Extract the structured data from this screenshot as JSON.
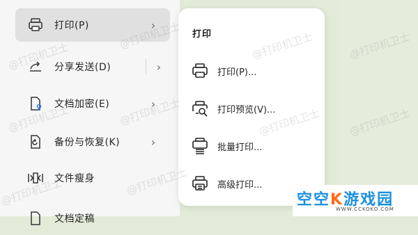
{
  "left_menu": {
    "items": [
      {
        "label": "打印(P)",
        "icon": "printer-icon"
      },
      {
        "label": "分享发送(D)",
        "icon": "share-icon"
      },
      {
        "label": "文档加密(E)",
        "icon": "document-lock-icon"
      },
      {
        "label": "备份与恢复(K)",
        "icon": "backup-icon"
      },
      {
        "label": "文件瘦身",
        "icon": "compress-icon"
      },
      {
        "label": "文档定稿",
        "icon": "document-finalize-icon"
      }
    ]
  },
  "submenu": {
    "title": "打印",
    "items": [
      {
        "label": "打印(P)...",
        "icon": "printer-icon"
      },
      {
        "label": "打印预览(V)...",
        "icon": "print-preview-icon"
      },
      {
        "label": "批量打印...",
        "icon": "batch-print-icon"
      },
      {
        "label": "高级打印...",
        "icon": "advanced-print-icon"
      }
    ]
  },
  "watermark": {
    "text": "@打印机卫士"
  },
  "brand": {
    "name_part1": "空空",
    "name_k": "K",
    "name_part2": "游戏园",
    "url": "WWW.CCKOKO.COM",
    "color": "#1a8fe0",
    "accent": "#ff6b1a"
  },
  "colors": {
    "active_item_bg": "#e0e0e0",
    "background_green": "#e3ead8"
  }
}
